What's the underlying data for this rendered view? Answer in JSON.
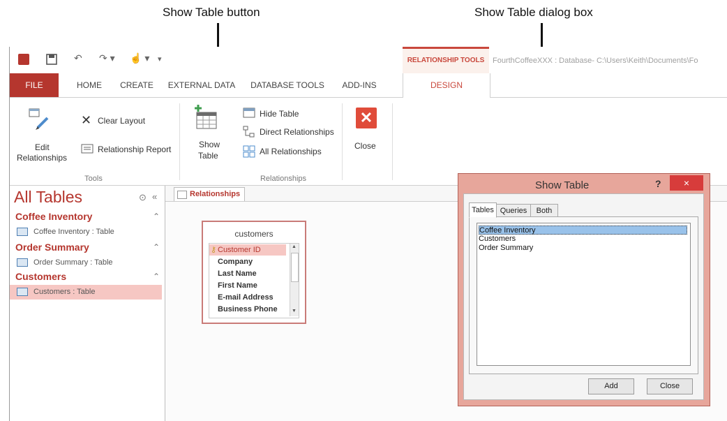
{
  "callouts": {
    "show_table_button": "Show Table button",
    "show_table_dialog": "Show Table dialog box"
  },
  "titlebar": {
    "context_label": "RELATIONSHIP TOOLS",
    "title": "FourthCoffeeXXX : Database- C:\\Users\\Keith\\Documents\\Fo"
  },
  "tabs": {
    "file": "FILE",
    "home": "HOME",
    "create": "CREATE",
    "external_data": "EXTERNAL DATA",
    "database_tools": "DATABASE TOOLS",
    "add_ins": "ADD-INS",
    "design": "DESIGN"
  },
  "ribbon": {
    "edit_relationships_line1": "Edit",
    "edit_relationships_line2": "Relationships",
    "clear_layout": "Clear Layout",
    "relationship_report": "Relationship Report",
    "tools_group": "Tools",
    "show_table_line1": "Show",
    "show_table_line2": "Table",
    "hide_table": "Hide Table",
    "direct_relationships": "Direct Relationships",
    "all_relationships": "All Relationships",
    "relationships_group": "Relationships",
    "close": "Close"
  },
  "nav": {
    "title": "All Tables",
    "groups": [
      {
        "name": "Coffee Inventory",
        "item": "Coffee Inventory : Table"
      },
      {
        "name": "Order Summary",
        "item": "Order Summary : Table"
      },
      {
        "name": "Customers",
        "item": "Customers : Table"
      }
    ]
  },
  "document": {
    "tab": "Relationships",
    "table_box": {
      "title": "customers",
      "fields": [
        "Customer ID",
        "Company",
        "Last Name",
        "First Name",
        "E-mail Address",
        "Business Phone"
      ]
    }
  },
  "dialog": {
    "title": "Show Table",
    "help": "?",
    "close_symbol": "×",
    "tabs": [
      "Tables",
      "Queries",
      "Both"
    ],
    "items": [
      "Coffee Inventory",
      "Customers",
      "Order Summary"
    ],
    "add_button": "Add",
    "close_button": "Close"
  },
  "colors": {
    "accent": "#b5362e",
    "context": "#c9483c",
    "dialog_border": "#e7a69b",
    "selection": "#99c2ea"
  }
}
